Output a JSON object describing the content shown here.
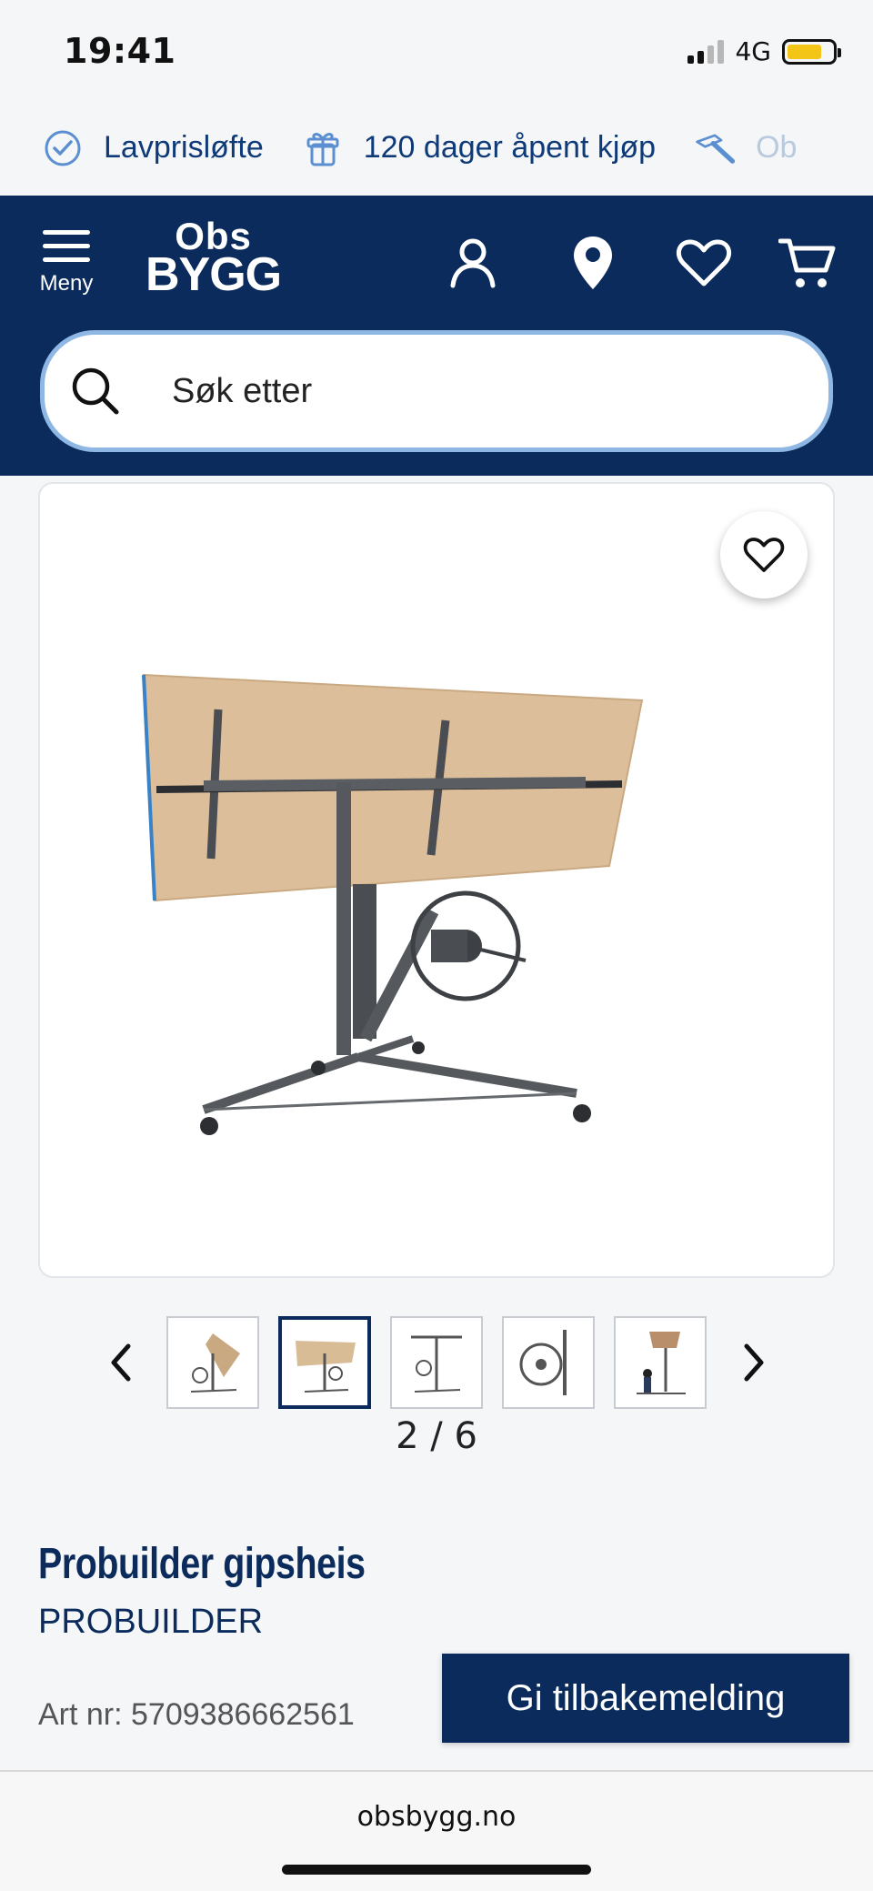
{
  "status_bar": {
    "time": "19:41",
    "network": "4G",
    "battery_level": 0.78,
    "battery_color": "#f2c516"
  },
  "usp_bar": {
    "items": [
      {
        "icon": "check-circle-icon",
        "label": "Lavprisløfte"
      },
      {
        "icon": "gift-box-icon",
        "label": "120 dager åpent kjøp"
      },
      {
        "icon": "hammer-icon",
        "label": "Ob"
      }
    ]
  },
  "header": {
    "menu_label": "Meny",
    "logo_top": "Obs",
    "logo_bottom": "BYGG",
    "icons": [
      "user-icon",
      "location-pin-icon",
      "heart-icon",
      "cart-icon"
    ],
    "background_color": "#0a2b5c"
  },
  "search": {
    "placeholder": "Søk etter"
  },
  "gallery": {
    "current": 2,
    "total": 6,
    "pager_text": "2 / 6",
    "thumbnail_count": 5,
    "active_thumbnail": 2
  },
  "product": {
    "title": "Probuilder gipsheis",
    "brand": "PROBUILDER",
    "article_number": "Art nr: 5709386662561"
  },
  "feedback_button": {
    "label": "Gi tilbakemelding"
  },
  "browser": {
    "url": "obsbygg.no"
  }
}
